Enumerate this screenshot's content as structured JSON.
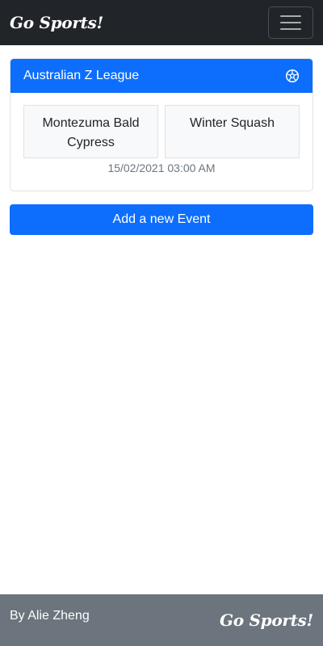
{
  "navbar": {
    "brand": "Go Sports!",
    "menu_icon": "hamburger-menu-icon"
  },
  "event": {
    "league": "Australian Z League",
    "sport_icon": "soccer-ball-icon",
    "team_home": "Montezuma Bald Cypress",
    "team_away": "Winter Squash",
    "datetime": "15/02/2021 03:00 AM"
  },
  "actions": {
    "add_event_label": "Add a new Event"
  },
  "footer": {
    "author": "By Alie Zheng",
    "brand": "Go Sports!"
  },
  "colors": {
    "navbar_bg": "#212529",
    "primary": "#0d6efd",
    "footer_bg": "#6c757d",
    "team_bg": "#f8f9fa",
    "muted_text": "#6c757d"
  }
}
